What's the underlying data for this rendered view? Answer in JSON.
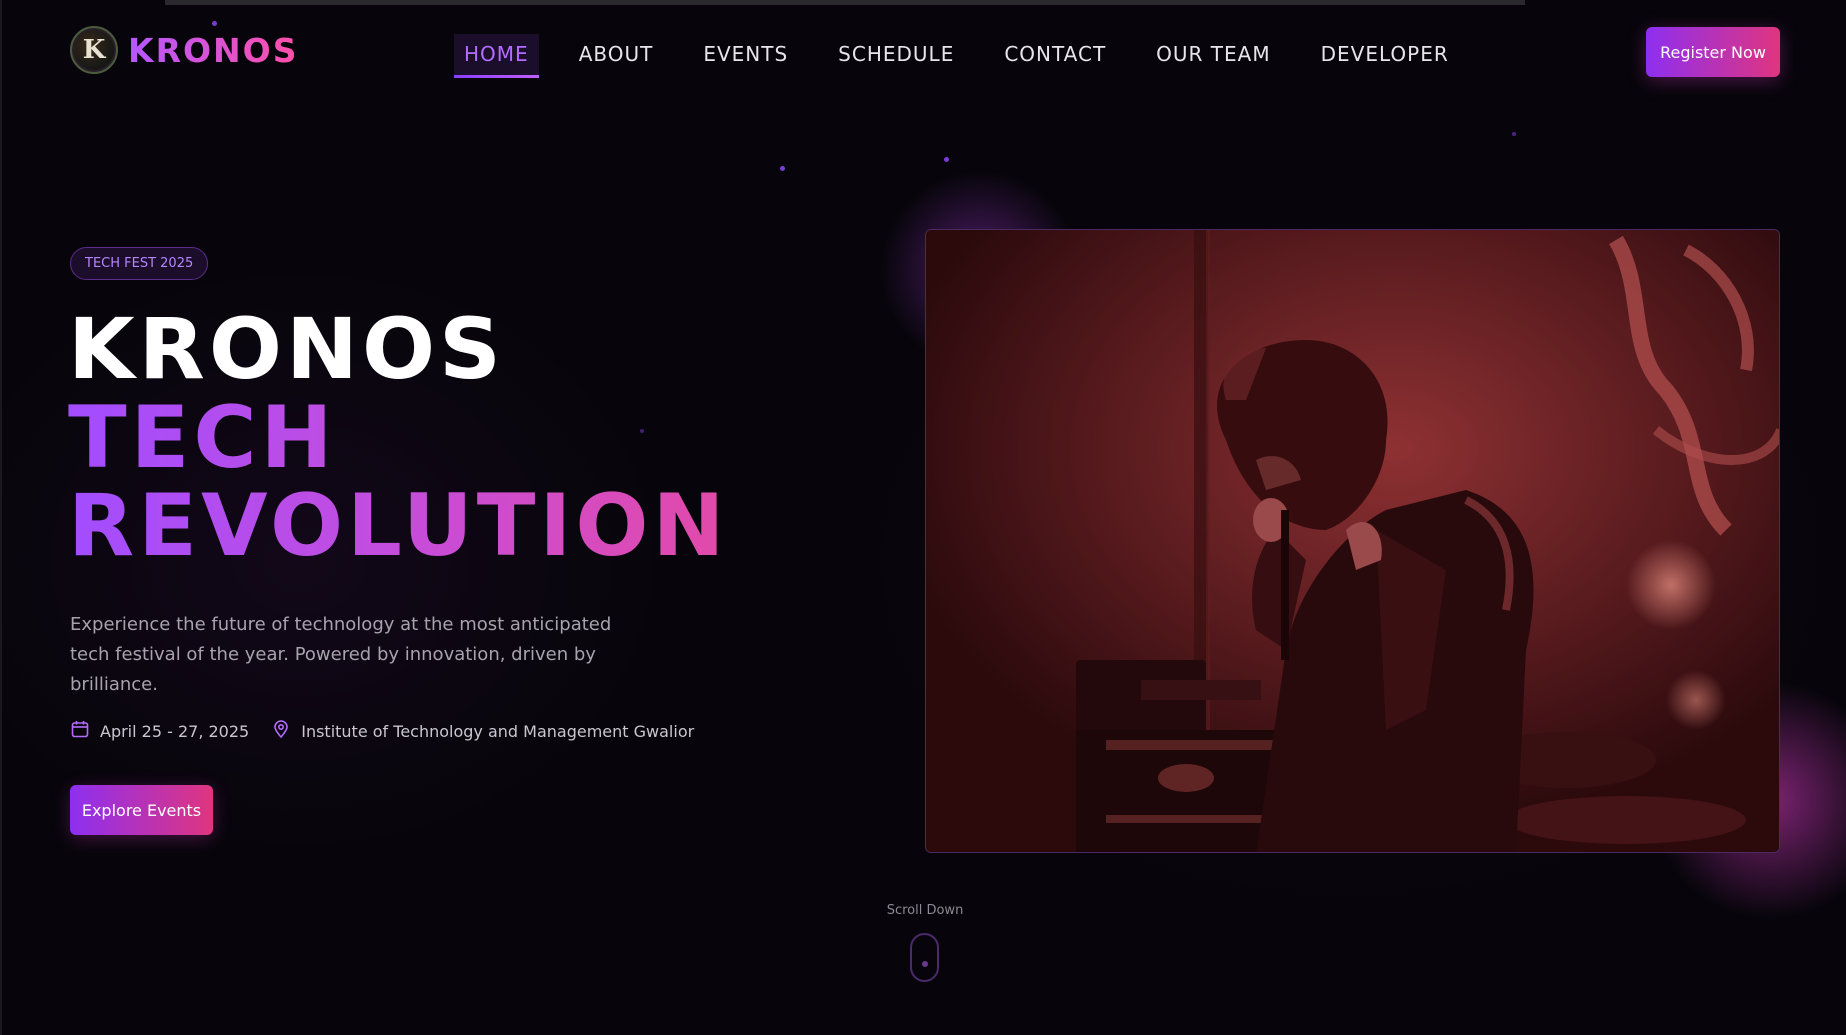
{
  "brand": {
    "name": "KRONOS",
    "logo_letter": "K"
  },
  "nav": {
    "items": [
      {
        "label": "HOME",
        "active": true
      },
      {
        "label": "ABOUT",
        "active": false
      },
      {
        "label": "EVENTS",
        "active": false
      },
      {
        "label": "SCHEDULE",
        "active": false
      },
      {
        "label": "CONTACT",
        "active": false
      },
      {
        "label": "OUR TEAM",
        "active": false
      },
      {
        "label": "DEVELOPER",
        "active": false
      }
    ],
    "register_label": "Register Now"
  },
  "hero": {
    "badge": "TECH FEST 2025",
    "title_line1": "KRONOS",
    "title_line2": "TECH",
    "title_line3": "REVOLUTION",
    "description": "Experience the future of technology at the most anticipated tech festival of the year. Powered by innovation, driven by brilliance.",
    "date": "April 25 - 27, 2025",
    "venue": "Institute of Technology and Management Gwalior",
    "cta_label": "Explore Events",
    "image_alt": "Singer performing on stage with microphone"
  },
  "scroll": {
    "label": "Scroll Down"
  },
  "colors": {
    "background": "#07050b",
    "accent_purple": "#a24dff",
    "accent_pink": "#e24aa8",
    "image_tint": "#5a1c20"
  },
  "icons": {
    "date": "calendar-icon",
    "venue": "location-pin-icon"
  }
}
